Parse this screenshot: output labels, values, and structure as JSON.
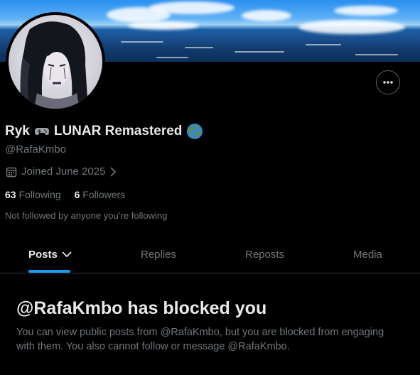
{
  "profile": {
    "name_prefix": "Ryk",
    "name_main": "LUNAR Remastered",
    "handle": "@RafaKmbo",
    "joined": "Joined June 2025",
    "following_count": "63",
    "following_label": "Following",
    "followers_count": "6",
    "followers_label": "Followers",
    "not_followed_text": "Not followed by anyone you’re following"
  },
  "tabs": [
    {
      "label": "Posts",
      "active": true
    },
    {
      "label": "Replies",
      "active": false
    },
    {
      "label": "Reposts",
      "active": false
    },
    {
      "label": "Media",
      "active": false
    }
  ],
  "blocked": {
    "title": "@RafaKmbo has blocked you",
    "description": "You can view public posts from @RafaKmbo, but you are blocked from engaging with them. You also cannot follow or message @RafaKmbo."
  },
  "icons": {
    "more": "more-horizontal-icon",
    "gamepad": "gamepad-icon",
    "globe": "globe-icon",
    "calendar": "calendar-icon",
    "chevron_right": "chevron-right-icon",
    "chevron_down": "chevron-down-icon"
  },
  "colors": {
    "background": "#000000",
    "text_primary": "#e7e9ea",
    "text_secondary": "#71767b",
    "accent": "#1d9bf0",
    "border": "#2f3336"
  }
}
